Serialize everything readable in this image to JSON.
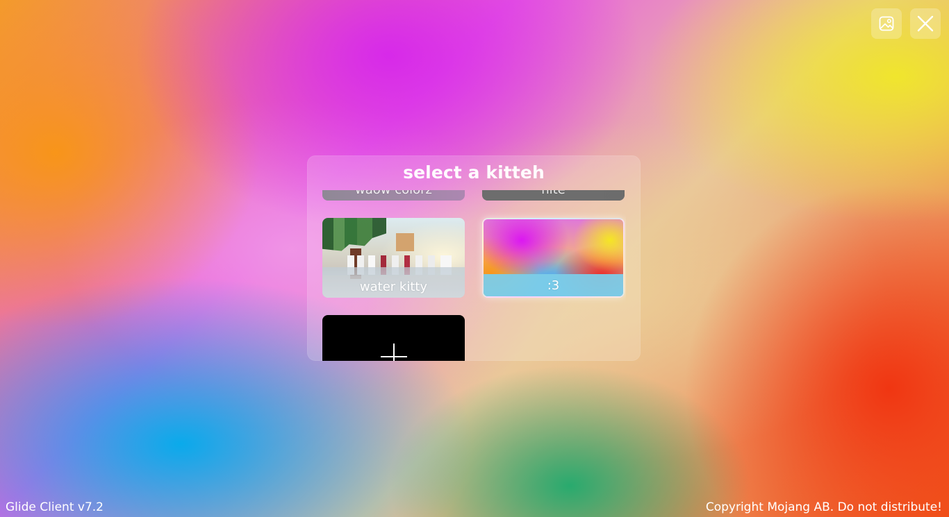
{
  "top_buttons": {
    "gallery_icon": "image-icon",
    "close_icon": "close-icon"
  },
  "modal": {
    "title": "select a kitteh",
    "cards": [
      {
        "label": "waow colorz"
      },
      {
        "label": "nite"
      },
      {
        "label": "water kitty"
      },
      {
        "label": ":3",
        "selected": true
      },
      {
        "label": "",
        "type": "add",
        "icon": "plus-icon"
      }
    ]
  },
  "footer": {
    "left_text": "Glide Client v7.2",
    "right_text": "Copyright Mojang AB. Do not distribute!"
  }
}
